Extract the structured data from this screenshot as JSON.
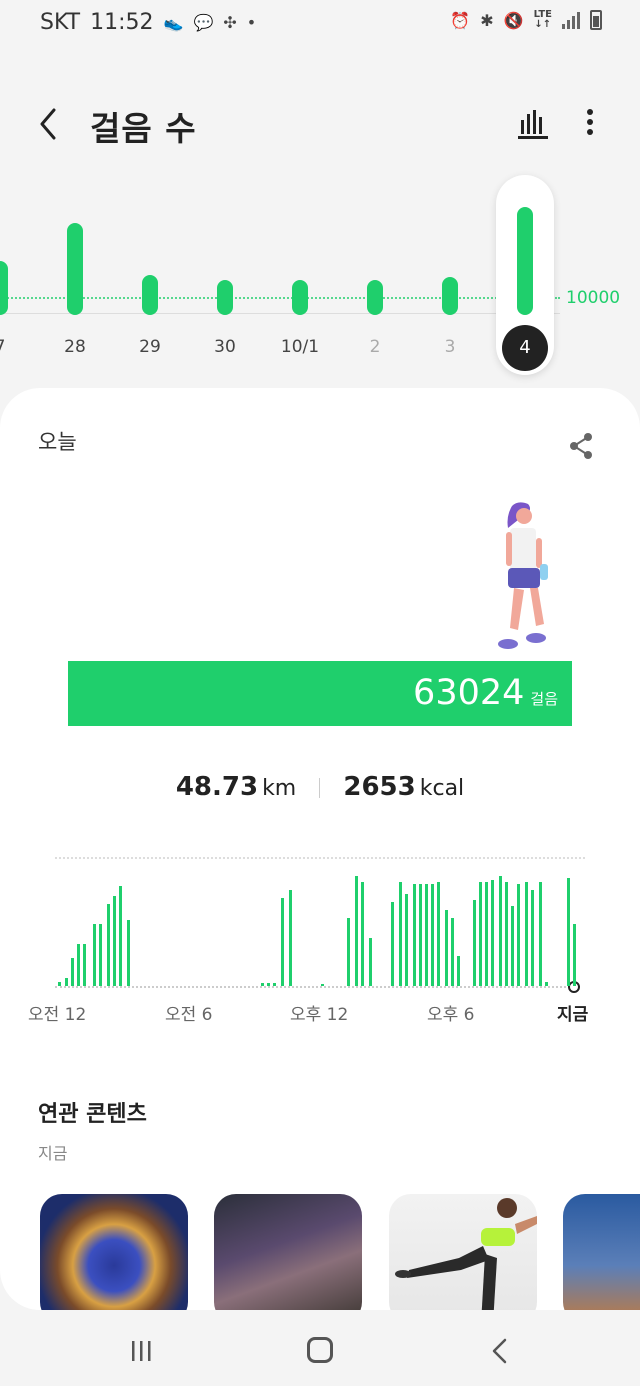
{
  "status_bar": {
    "carrier": "SKT",
    "time": "11:52",
    "network": "LTE"
  },
  "header": {
    "title": "걸음 수"
  },
  "week": {
    "goal_label": "10000",
    "days": [
      {
        "label": "7"
      },
      {
        "label": "28"
      },
      {
        "label": "29"
      },
      {
        "label": "30"
      },
      {
        "label": "10/1"
      },
      {
        "label": "2"
      },
      {
        "label": "3"
      }
    ],
    "selected_label": "4"
  },
  "today": {
    "label": "오늘",
    "steps": "63024",
    "steps_unit": "걸음",
    "distance": "48.73",
    "distance_unit": "km",
    "calories": "2653",
    "calories_unit": "kcal"
  },
  "hourly_axis": {
    "labels": [
      "오전 12",
      "오전 6",
      "오후 12",
      "오후 6",
      "지금"
    ]
  },
  "related": {
    "title": "연관 콘텐츠",
    "subtitle": "지금"
  },
  "colors": {
    "accent": "#1fcf6c",
    "dark": "#222222"
  }
}
